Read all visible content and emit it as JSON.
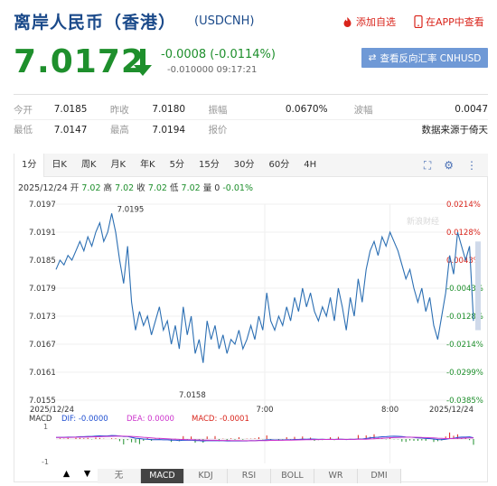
{
  "header": {
    "title": "离岸人民币（香港）",
    "code": "(USDCNH)",
    "add_fav": "添加自选",
    "app_view": "在APP中查看"
  },
  "quote": {
    "price": "7.0172",
    "change": "-0.0008 (-0.0114%)",
    "subinfo": "-0.010000 09:17:21",
    "reverse_button": "查看反向汇率 CNHUSD"
  },
  "stats": [
    [
      {
        "label": "今开",
        "value": "7.0185"
      },
      {
        "label": "昨收",
        "value": "7.0180"
      },
      {
        "label": "振幅",
        "value": "0.0670%"
      },
      {
        "label": "波幅",
        "value": "0.0047"
      }
    ],
    [
      {
        "label": "最低",
        "value": "7.0147"
      },
      {
        "label": "最高",
        "value": "7.0194"
      },
      {
        "label": "报价",
        "value": ""
      },
      {
        "label": "",
        "value": "数据来源于倚天"
      }
    ]
  ],
  "tabs": [
    "1分",
    "日K",
    "周K",
    "月K",
    "年K",
    "5分",
    "15分",
    "30分",
    "60分",
    "4H"
  ],
  "ohlc_line": {
    "date": "2025/12/24",
    "open_label": "开",
    "open": "7.02",
    "high_label": "高",
    "high": "7.02",
    "close_label": "收",
    "close": "7.02",
    "low_label": "低",
    "low": "7.02",
    "vol_label": "量",
    "vol": "0",
    "pct": "-0.01%"
  },
  "chart_data": {
    "type": "line",
    "yticks": [
      "7.0197",
      "7.0191",
      "7.0185",
      "7.0179",
      "7.0173",
      "7.0167",
      "7.0161",
      "7.0155"
    ],
    "pct_ticks": [
      "0.0214%",
      "0.0128%",
      "0.0043%",
      "-0.0043%",
      "-0.0128%",
      "-0.0214%",
      "-0.0299%",
      "-0.0385%"
    ],
    "ylim": [
      7.0155,
      7.0197
    ],
    "xticks": [
      "2025/12/24",
      "7:00",
      "8:00",
      "2025/12/24"
    ],
    "xtick_positions": [
      0.0,
      0.5,
      0.8,
      1.0
    ],
    "annotations": {
      "high": "7.0195",
      "low": "7.0158"
    },
    "watermark": "新浪财经",
    "series_values": [
      7.0183,
      7.0185,
      7.0184,
      7.0186,
      7.0185,
      7.0187,
      7.0189,
      7.0187,
      7.019,
      7.0188,
      7.0191,
      7.0193,
      7.0189,
      7.0191,
      7.0195,
      7.0191,
      7.0185,
      7.018,
      7.0188,
      7.0176,
      7.017,
      7.0174,
      7.0171,
      7.0173,
      7.0169,
      7.0172,
      7.0175,
      7.017,
      7.0172,
      7.0167,
      7.0171,
      7.0166,
      7.0175,
      7.0169,
      7.0173,
      7.0165,
      7.0168,
      7.0163,
      7.0172,
      7.0168,
      7.0171,
      7.0166,
      7.0169,
      7.0165,
      7.0168,
      7.0167,
      7.017,
      7.0166,
      7.0168,
      7.0171,
      7.0168,
      7.0173,
      7.017,
      7.0178,
      7.0172,
      7.017,
      7.0173,
      7.0171,
      7.0175,
      7.0172,
      7.0177,
      7.0174,
      7.0179,
      7.0175,
      7.0178,
      7.0174,
      7.0172,
      7.0175,
      7.0173,
      7.0177,
      7.0172,
      7.0179,
      7.0175,
      7.017,
      7.0177,
      7.0173,
      7.0181,
      7.0176,
      7.0183,
      7.0187,
      7.0189,
      7.0186,
      7.019,
      7.0188,
      7.0191,
      7.0189,
      7.0187,
      7.0184,
      7.0181,
      7.0183,
      7.0179,
      7.0176,
      7.0179,
      7.0174,
      7.0177,
      7.0171,
      7.0168,
      7.0173,
      7.0178,
      7.0186,
      7.0182,
      7.0191,
      7.0188,
      7.0185,
      7.0188,
      7.0172
    ]
  },
  "macd": {
    "label": "MACD",
    "dif": "DIF: -0.0000",
    "dea": "DEA: 0.0000",
    "macd": "MACD: -0.0001",
    "ytick_top": "1",
    "ytick_bottom": "-1"
  },
  "indicators": [
    "无",
    "MACD",
    "KDJ",
    "RSI",
    "BOLL",
    "WR",
    "DMI"
  ],
  "colors": {
    "up": "#d9241b",
    "down": "#1e8f2c",
    "line": "#2c6fb3",
    "dif": "#1f4fd1",
    "dea": "#cc33cc",
    "macd": "#d9241b"
  }
}
